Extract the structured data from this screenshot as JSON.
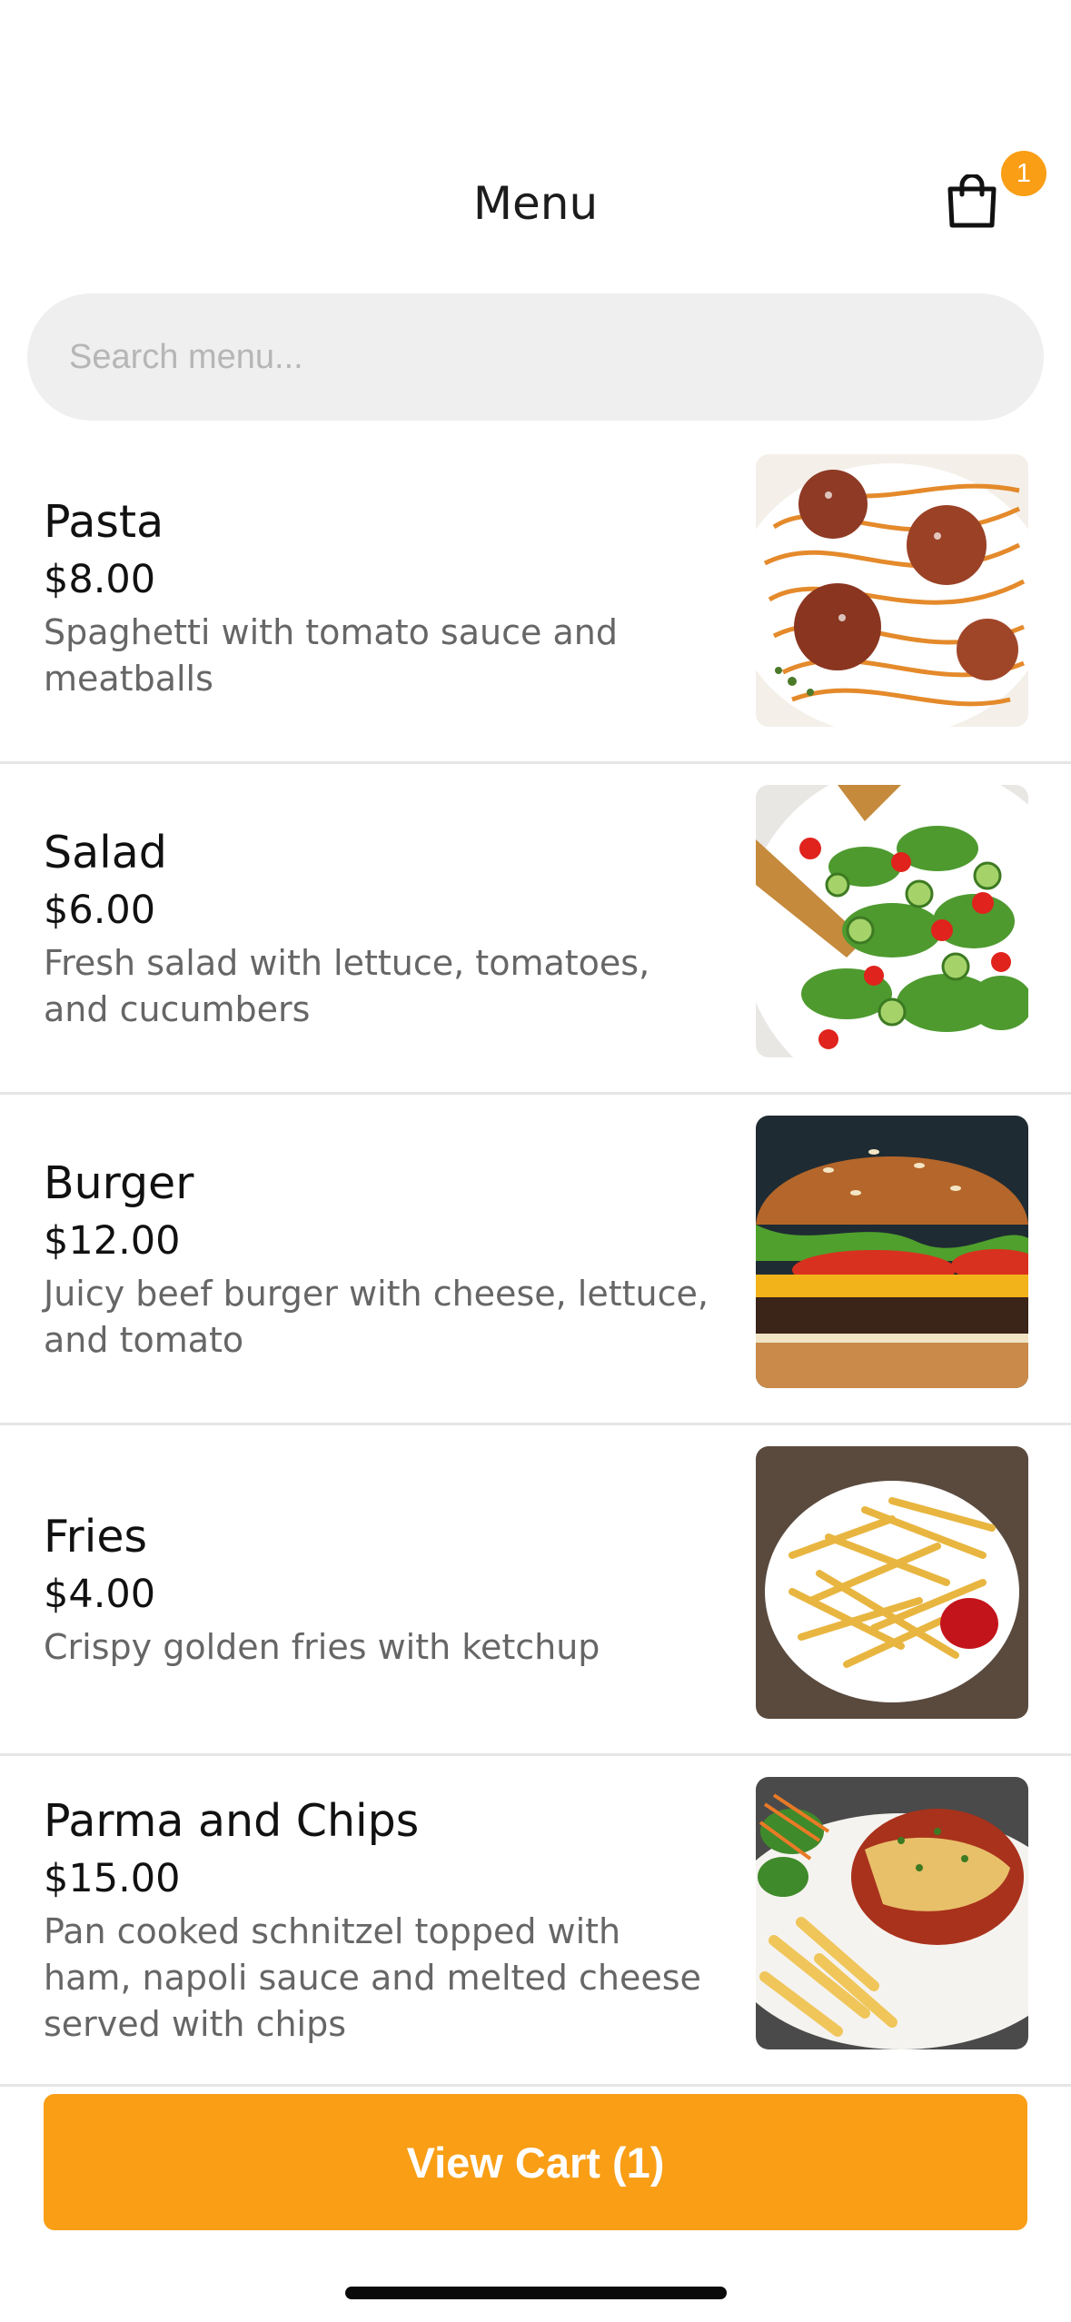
{
  "header": {
    "title": "Menu",
    "cart_badge": "1",
    "cart_icon": "shopping-bag-icon"
  },
  "search": {
    "placeholder": "Search menu...",
    "value": ""
  },
  "items": [
    {
      "name": "Pasta",
      "price": "$8.00",
      "description": "Spaghetti with tomato sauce and meatballs"
    },
    {
      "name": "Salad",
      "price": "$6.00",
      "description": "Fresh salad with lettuce, tomatoes, and cucumbers"
    },
    {
      "name": "Burger",
      "price": "$12.00",
      "description": "Juicy beef burger with cheese, lettuce, and tomato"
    },
    {
      "name": "Fries",
      "price": "$4.00",
      "description": "Crispy golden fries with ketchup"
    },
    {
      "name": "Parma and Chips",
      "price": "$15.00",
      "description": "Pan cooked schnitzel topped with ham, napoli sauce and melted cheese served with chips"
    }
  ],
  "footer": {
    "view_cart_label": "View Cart (1)"
  },
  "colors": {
    "accent": "#f99e15",
    "search_bg": "#efefef",
    "divider": "#e6e6e6"
  }
}
